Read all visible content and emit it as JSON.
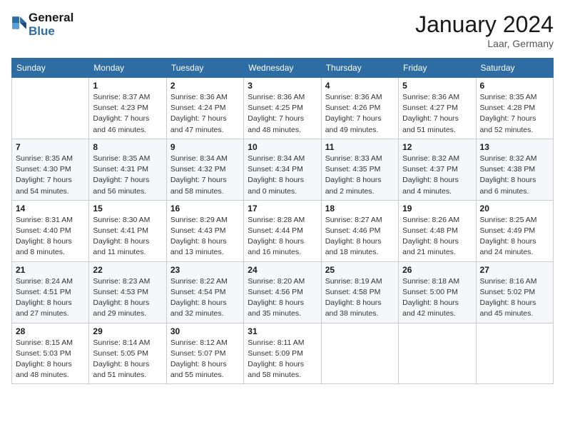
{
  "header": {
    "logo_line1": "General",
    "logo_line2": "Blue",
    "month": "January 2024",
    "location": "Laar, Germany"
  },
  "days_of_week": [
    "Sunday",
    "Monday",
    "Tuesday",
    "Wednesday",
    "Thursday",
    "Friday",
    "Saturday"
  ],
  "weeks": [
    [
      {
        "day": "",
        "info": ""
      },
      {
        "day": "1",
        "info": "Sunrise: 8:37 AM\nSunset: 4:23 PM\nDaylight: 7 hours\nand 46 minutes."
      },
      {
        "day": "2",
        "info": "Sunrise: 8:36 AM\nSunset: 4:24 PM\nDaylight: 7 hours\nand 47 minutes."
      },
      {
        "day": "3",
        "info": "Sunrise: 8:36 AM\nSunset: 4:25 PM\nDaylight: 7 hours\nand 48 minutes."
      },
      {
        "day": "4",
        "info": "Sunrise: 8:36 AM\nSunset: 4:26 PM\nDaylight: 7 hours\nand 49 minutes."
      },
      {
        "day": "5",
        "info": "Sunrise: 8:36 AM\nSunset: 4:27 PM\nDaylight: 7 hours\nand 51 minutes."
      },
      {
        "day": "6",
        "info": "Sunrise: 8:35 AM\nSunset: 4:28 PM\nDaylight: 7 hours\nand 52 minutes."
      }
    ],
    [
      {
        "day": "7",
        "info": "Sunrise: 8:35 AM\nSunset: 4:30 PM\nDaylight: 7 hours\nand 54 minutes."
      },
      {
        "day": "8",
        "info": "Sunrise: 8:35 AM\nSunset: 4:31 PM\nDaylight: 7 hours\nand 56 minutes."
      },
      {
        "day": "9",
        "info": "Sunrise: 8:34 AM\nSunset: 4:32 PM\nDaylight: 7 hours\nand 58 minutes."
      },
      {
        "day": "10",
        "info": "Sunrise: 8:34 AM\nSunset: 4:34 PM\nDaylight: 8 hours\nand 0 minutes."
      },
      {
        "day": "11",
        "info": "Sunrise: 8:33 AM\nSunset: 4:35 PM\nDaylight: 8 hours\nand 2 minutes."
      },
      {
        "day": "12",
        "info": "Sunrise: 8:32 AM\nSunset: 4:37 PM\nDaylight: 8 hours\nand 4 minutes."
      },
      {
        "day": "13",
        "info": "Sunrise: 8:32 AM\nSunset: 4:38 PM\nDaylight: 8 hours\nand 6 minutes."
      }
    ],
    [
      {
        "day": "14",
        "info": "Sunrise: 8:31 AM\nSunset: 4:40 PM\nDaylight: 8 hours\nand 8 minutes."
      },
      {
        "day": "15",
        "info": "Sunrise: 8:30 AM\nSunset: 4:41 PM\nDaylight: 8 hours\nand 11 minutes."
      },
      {
        "day": "16",
        "info": "Sunrise: 8:29 AM\nSunset: 4:43 PM\nDaylight: 8 hours\nand 13 minutes."
      },
      {
        "day": "17",
        "info": "Sunrise: 8:28 AM\nSunset: 4:44 PM\nDaylight: 8 hours\nand 16 minutes."
      },
      {
        "day": "18",
        "info": "Sunrise: 8:27 AM\nSunset: 4:46 PM\nDaylight: 8 hours\nand 18 minutes."
      },
      {
        "day": "19",
        "info": "Sunrise: 8:26 AM\nSunset: 4:48 PM\nDaylight: 8 hours\nand 21 minutes."
      },
      {
        "day": "20",
        "info": "Sunrise: 8:25 AM\nSunset: 4:49 PM\nDaylight: 8 hours\nand 24 minutes."
      }
    ],
    [
      {
        "day": "21",
        "info": "Sunrise: 8:24 AM\nSunset: 4:51 PM\nDaylight: 8 hours\nand 27 minutes."
      },
      {
        "day": "22",
        "info": "Sunrise: 8:23 AM\nSunset: 4:53 PM\nDaylight: 8 hours\nand 29 minutes."
      },
      {
        "day": "23",
        "info": "Sunrise: 8:22 AM\nSunset: 4:54 PM\nDaylight: 8 hours\nand 32 minutes."
      },
      {
        "day": "24",
        "info": "Sunrise: 8:20 AM\nSunset: 4:56 PM\nDaylight: 8 hours\nand 35 minutes."
      },
      {
        "day": "25",
        "info": "Sunrise: 8:19 AM\nSunset: 4:58 PM\nDaylight: 8 hours\nand 38 minutes."
      },
      {
        "day": "26",
        "info": "Sunrise: 8:18 AM\nSunset: 5:00 PM\nDaylight: 8 hours\nand 42 minutes."
      },
      {
        "day": "27",
        "info": "Sunrise: 8:16 AM\nSunset: 5:02 PM\nDaylight: 8 hours\nand 45 minutes."
      }
    ],
    [
      {
        "day": "28",
        "info": "Sunrise: 8:15 AM\nSunset: 5:03 PM\nDaylight: 8 hours\nand 48 minutes."
      },
      {
        "day": "29",
        "info": "Sunrise: 8:14 AM\nSunset: 5:05 PM\nDaylight: 8 hours\nand 51 minutes."
      },
      {
        "day": "30",
        "info": "Sunrise: 8:12 AM\nSunset: 5:07 PM\nDaylight: 8 hours\nand 55 minutes."
      },
      {
        "day": "31",
        "info": "Sunrise: 8:11 AM\nSunset: 5:09 PM\nDaylight: 8 hours\nand 58 minutes."
      },
      {
        "day": "",
        "info": ""
      },
      {
        "day": "",
        "info": ""
      },
      {
        "day": "",
        "info": ""
      }
    ]
  ]
}
